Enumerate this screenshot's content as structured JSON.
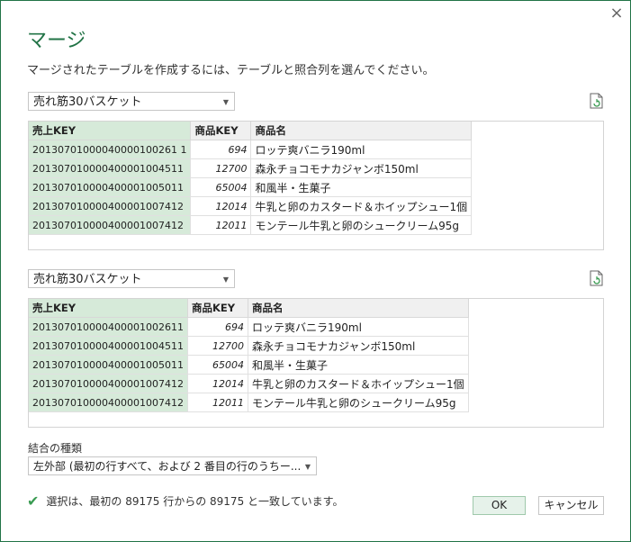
{
  "dialog": {
    "title": "マージ",
    "description": "マージされたテーブルを作成するには、テーブルと照合列を選んでください。",
    "close_icon": "×"
  },
  "table1": {
    "selected": "売れ筋30バスケット",
    "columns": [
      "売上KEY",
      "商品KEY",
      "商品名"
    ],
    "rows": [
      [
        "20130701000040000100261 1",
        "694",
        "ロッテ爽バニラ190ml"
      ],
      [
        "201307010000400001004511",
        "12700",
        "森永チョコモナカジャンボ150ml"
      ],
      [
        "201307010000400001005011",
        "65004",
        "和風半・生菓子"
      ],
      [
        "201307010000400001007412",
        "12014",
        "牛乳と卵のカスタード＆ホイップシュー1個"
      ],
      [
        "201307010000400001007412",
        "12011",
        "モンテール牛乳と卵のシュークリーム95g"
      ]
    ]
  },
  "table2": {
    "selected": "売れ筋30バスケット",
    "columns": [
      "売上KEY",
      "商品KEY",
      "商品名"
    ],
    "rows": [
      [
        "201307010000400001002611",
        "694",
        "ロッテ爽バニラ190ml"
      ],
      [
        "201307010000400001004511",
        "12700",
        "森永チョコモナカジャンボ150ml"
      ],
      [
        "201307010000400001005011",
        "65004",
        "和風半・生菓子"
      ],
      [
        "201307010000400001007412",
        "12014",
        "牛乳と卵のカスタード＆ホイップシュー1個"
      ],
      [
        "201307010000400001007412",
        "12011",
        "モンテール牛乳と卵のシュークリーム95g"
      ]
    ]
  },
  "join": {
    "label": "結合の種類",
    "selected": "左外部 (最初の行すべて、および 2 番目の行のうちー..."
  },
  "status": "選択は、最初の 89175 行からの 89175 と一致しています。",
  "buttons": {
    "ok": "OK",
    "cancel": "キャンセル"
  },
  "colors": {
    "accent": "#217346",
    "selected_column": "#d6ead9",
    "check": "#3a9b52"
  }
}
